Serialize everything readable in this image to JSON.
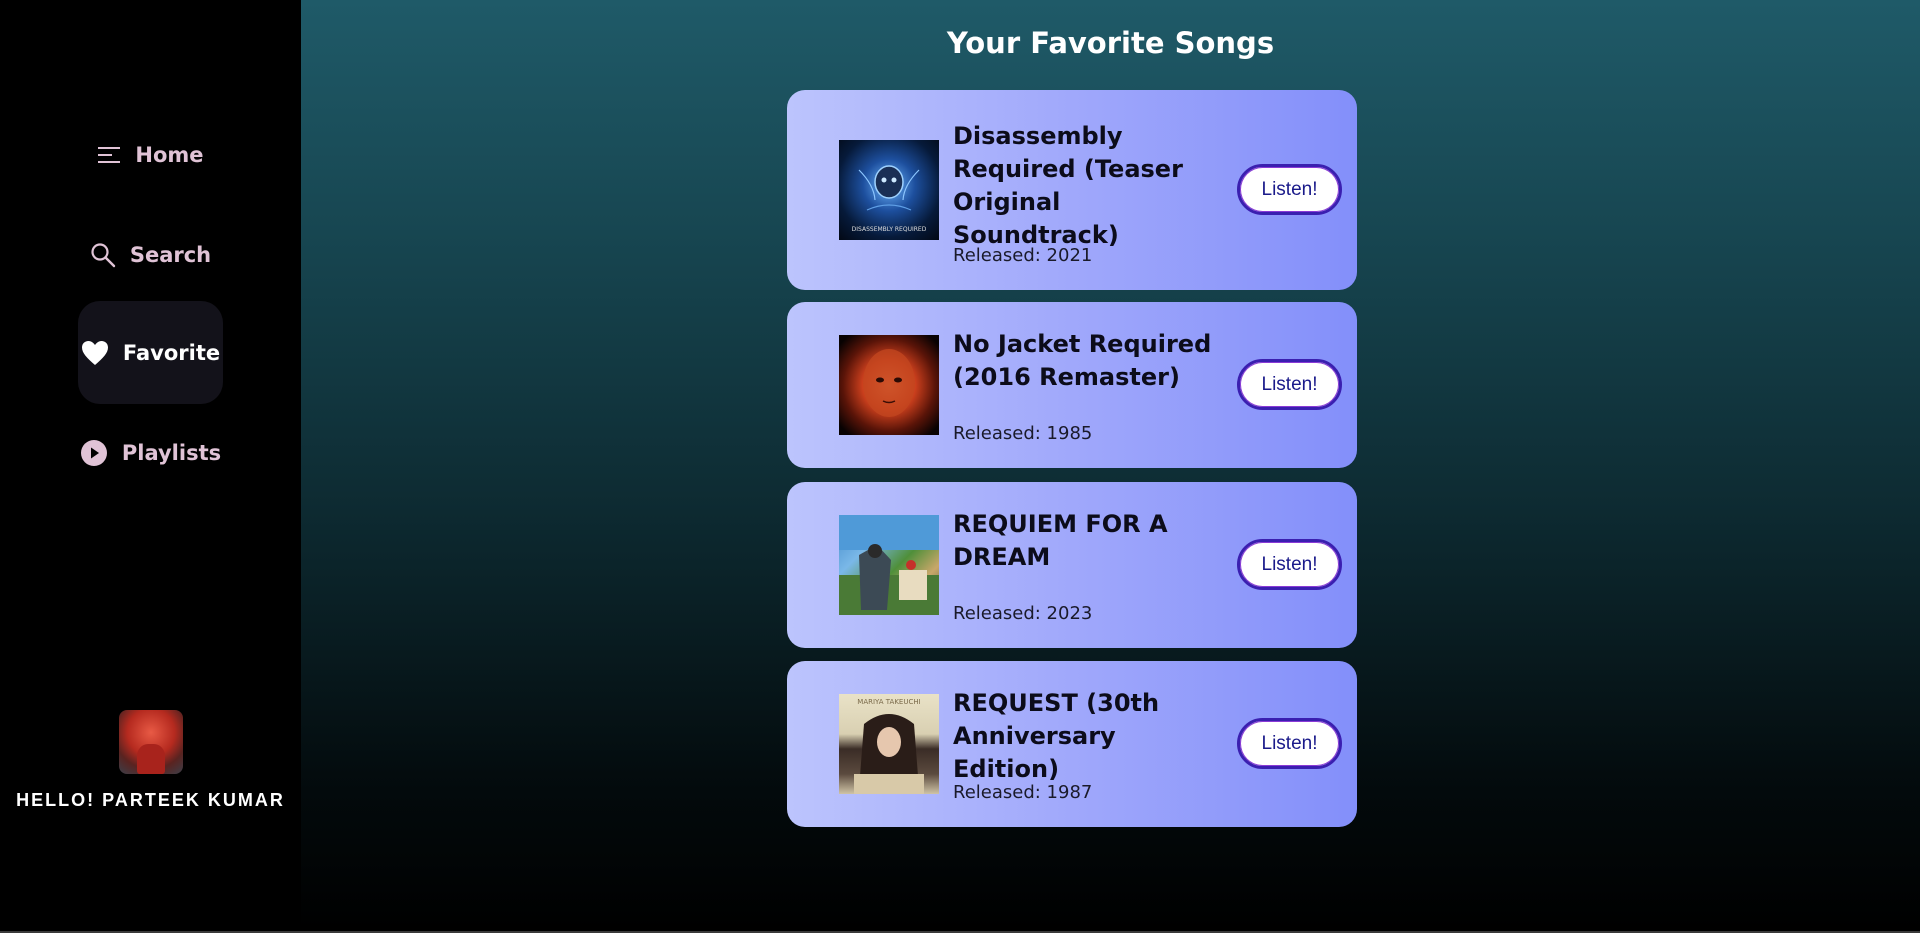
{
  "sidebar": {
    "items": [
      {
        "label": "Home",
        "icon": "menu-lines-icon"
      },
      {
        "label": "Search",
        "icon": "search-icon"
      },
      {
        "label": "Favorite",
        "icon": "heart-icon"
      },
      {
        "label": "Playlists",
        "icon": "play-circle-icon"
      }
    ],
    "active_item": "Favorite",
    "greeting": "HELLO! PARTEEK KUMAR"
  },
  "main": {
    "title": "Your Favorite Songs",
    "songs": [
      {
        "title": "Disassembly Required (Teaser Original Soundtrack)",
        "released": "Released: 2021",
        "button": "Listen!",
        "cover_text": "DISASSEMBLY REQUIRED"
      },
      {
        "title": "No Jacket Required (2016 Remaster)",
        "released": "Released: 1985",
        "button": "Listen!"
      },
      {
        "title": "REQUIEM FOR A DREAM",
        "released": "Released: 2023",
        "button": "Listen!"
      },
      {
        "title": "REQUEST (30th Anniversary Edition)",
        "released": "Released: 1987",
        "button": "Listen!",
        "cover_text": "MARIYA TAKEUCHI"
      }
    ]
  },
  "colors": {
    "sidebar_bg": "#000000",
    "card_gradient_start": "#bcc4fd",
    "card_gradient_end": "#838ffa",
    "button_border": "#3a1fb0",
    "nav_text": "#e0c3d6"
  }
}
